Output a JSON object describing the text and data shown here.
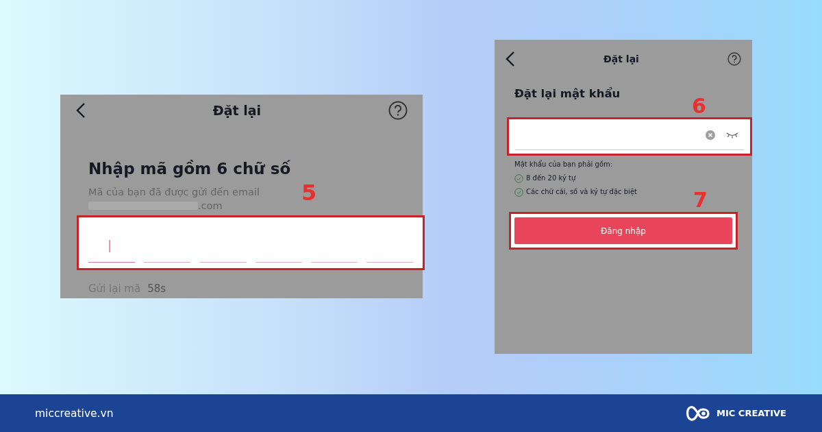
{
  "code_screen": {
    "title": "Đặt lại",
    "heading": "Nhập mã gồm 6 chữ số",
    "message": "Mã của bạn đã được gửi đến email",
    "email_visible": ".com",
    "digit_boxes": [
      {
        "focused": true
      },
      {
        "focused": false
      },
      {
        "focused": false
      },
      {
        "focused": false
      },
      {
        "focused": false
      },
      {
        "focused": false
      }
    ],
    "resend": {
      "label": "Gửi lại mã",
      "countdown": "58s"
    },
    "step": "5"
  },
  "password_screen": {
    "title": "Đặt lại",
    "heading": "Đặt lại mật khẩu",
    "field_step": "6",
    "requirements_title": "Mật khẩu của bạn phải gồm:",
    "requirements": [
      {
        "text": "8 đến 20 ký tự",
        "met": true
      },
      {
        "text": "Các chữ cái, số và ký tự đặc biệt",
        "met": true
      }
    ],
    "button": "Đăng nhập",
    "button_step": "7"
  },
  "footer": {
    "site": "miccreative.vn",
    "brand": "MIC CREATIVE"
  }
}
